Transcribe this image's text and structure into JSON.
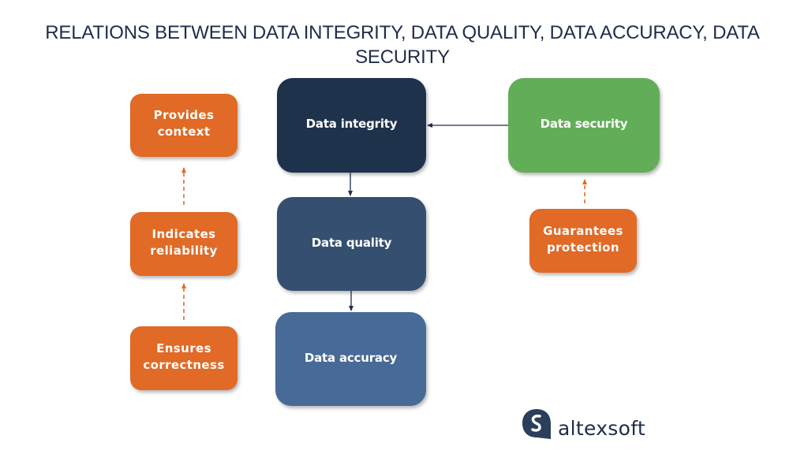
{
  "title": "RELATIONS BETWEEN DATA INTEGRITY, DATA QUALITY, DATA ACCURACY, DATA SECURITY",
  "nodes": {
    "integrity": "Data integrity",
    "quality": "Data quality",
    "accuracy": "Data accuracy",
    "security": "Data security",
    "provides_context": [
      "Provides",
      "context"
    ],
    "indicates_reliability": [
      "Indicates",
      "reliability"
    ],
    "ensures_correctness": [
      "Ensures",
      "correctness"
    ],
    "guarantees_protection": [
      "Guarantees",
      "protection"
    ]
  },
  "edges": [
    {
      "from": "security",
      "to": "integrity",
      "style": "solid"
    },
    {
      "from": "integrity",
      "to": "quality",
      "style": "solid"
    },
    {
      "from": "quality",
      "to": "accuracy",
      "style": "solid"
    },
    {
      "from": "ensures_correctness",
      "to": "indicates_reliability",
      "style": "dashed"
    },
    {
      "from": "indicates_reliability",
      "to": "provides_context",
      "style": "dashed"
    },
    {
      "from": "guarantees_protection",
      "to": "security",
      "style": "dashed"
    }
  ],
  "colors": {
    "title": "#1f2d4a",
    "integrity": "#1f324c",
    "quality": "#354f70",
    "accuracy": "#476a97",
    "security": "#62ad58",
    "annotation": "#e06a26",
    "solid_arrow": "#1f2d4a"
  },
  "logo": {
    "icon": "altexsoft-logo-icon",
    "text": "altexsoft"
  }
}
